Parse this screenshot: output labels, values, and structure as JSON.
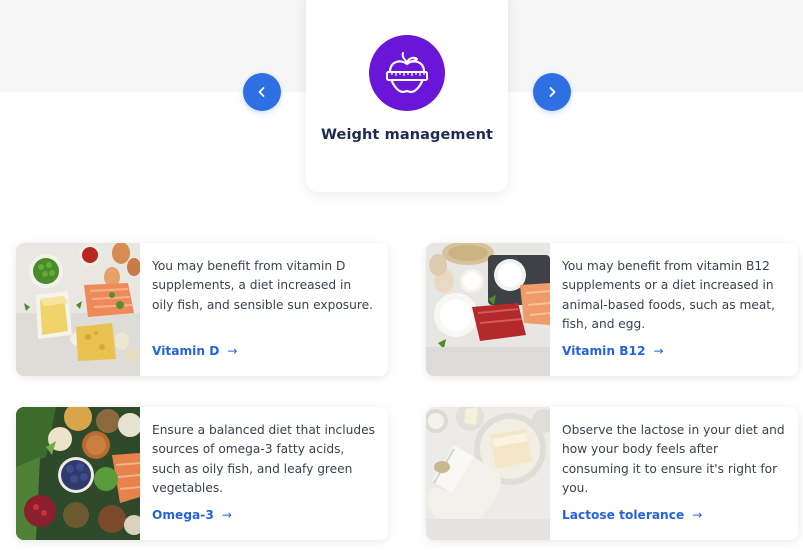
{
  "carousel": {
    "prev_icon": "chevron-left-icon",
    "next_icon": "chevron-right-icon",
    "feature": {
      "icon": "apple-measuring-tape-icon",
      "title": "Weight management"
    }
  },
  "cards": [
    {
      "image": "eggs-salmon-cheese-peas-photo",
      "text": "You may benefit from vitamin D supplements, a diet increased in oily fish, and sensible sun exposure.",
      "link": "Vitamin D",
      "arrow": "→"
    },
    {
      "image": "salmon-milk-eggs-oats-photo",
      "text": "You may benefit from vitamin B12 supplements or a diet increased in animal-based foods, such as meat, fish, and egg.",
      "link": "Vitamin B12",
      "arrow": "→"
    },
    {
      "image": "seeds-berries-greens-salmon-photo",
      "text": "Ensure a balanced diet that includes sources of omega-3 fatty acids, such as oily fish, and leafy green vegetables.",
      "link": "Omega-3",
      "arrow": "→"
    },
    {
      "image": "milk-bottle-cheese-bowls-photo",
      "text": "Observe the lactose in your diet and how your body feels after consuming it to ensure it's right for you.",
      "link": "Lactose tolerance",
      "arrow": "→"
    }
  ],
  "colors": {
    "accent_blue": "#2f6fe4",
    "feature_purple": "#6a16d8",
    "link_blue": "#2563d9",
    "title_navy": "#1f2a52"
  }
}
